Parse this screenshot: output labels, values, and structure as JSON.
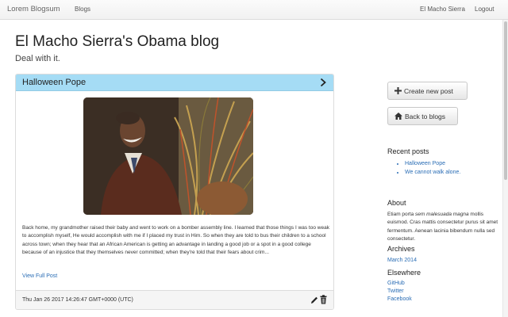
{
  "navbar": {
    "brand": "Lorem Blogsum",
    "blogs": "Blogs",
    "user": "El Macho Sierra",
    "logout": "Logout"
  },
  "page": {
    "title": "El Macho Sierra's Obama blog",
    "subtitle": "Deal with it."
  },
  "post": {
    "title": "Halloween Pope",
    "excerpt": "Back home, my grandmother raised their baby and went to work on a bomber assembly line. I learned that those things I was too weak to accomplish myself, He would accomplish with me if I placed my trust in Him. So when they are told to bus their children to a school across town; when they hear that an African American is getting an advantage in landing a good job or a spot in a good college because of an injustice that they themselves never committed; when they're told that their fears about crim...",
    "view_full": "View Full Post",
    "date": "Thu Jan 26 2017 14:26:47 GMT+0000 (UTC)",
    "header_color": "#a5dcf5"
  },
  "sidebar": {
    "create_label": "Create new post",
    "back_label": "Back to blogs",
    "recent_heading": "Recent posts",
    "recent": [
      "Halloween Pope",
      "We cannot walk alone."
    ],
    "about_heading": "About",
    "about_pre": "Etiam porta ",
    "about_em": "sem malesuada magna",
    "about_post": " mollis euismod. Cras mattis consectetur purus sit amet fermentum. Aenean lacinia bibendum nulla sed consectetur.",
    "archives_heading": "Archives",
    "archives": [
      "March 2014"
    ],
    "elsewhere_heading": "Elsewhere",
    "elsewhere": [
      "GitHub",
      "Twitter",
      "Facebook"
    ]
  },
  "colors": {
    "link": "#2a6db5",
    "accent": "#a5dcf5"
  },
  "icons": {
    "create": "plus-icon",
    "back": "home-icon",
    "expand": "chevron-right-icon",
    "edit": "pencil-icon",
    "delete": "trash-icon"
  }
}
